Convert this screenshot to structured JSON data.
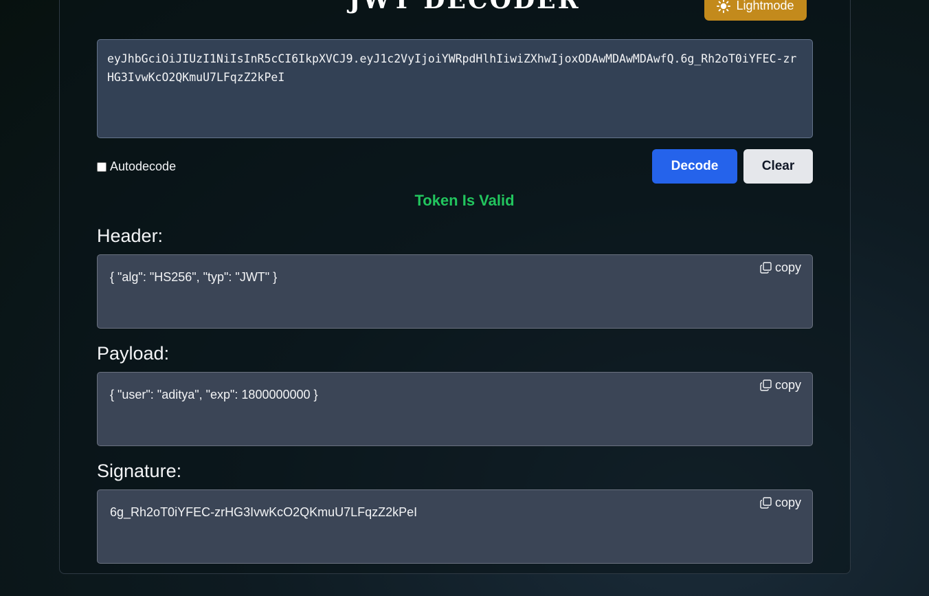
{
  "app": {
    "title": "JWT DECODER",
    "mode_button_label": "Lightmode",
    "mode_icon": "sun-icon"
  },
  "token_input": {
    "value": "eyJhbGciOiJIUzI1NiIsInR5cCI6IkpXVCJ9.eyJ1c2VyIjoiYWRpdHlhIiwiZXhwIjoxODAwMDAwMDAwfQ.6g_Rh2oT0iYFEC-zrHG3IvwKcO2QKmuU7LFqzZ2kPeI"
  },
  "controls": {
    "autodecode_label": "Autodecode",
    "autodecode_checked": false,
    "decode_label": "Decode",
    "clear_label": "Clear"
  },
  "status": {
    "text": "Token Is Valid",
    "color": "#22c55e"
  },
  "sections": {
    "header": {
      "label": "Header:",
      "content": "{ \"alg\": \"HS256\", \"typ\": \"JWT\" }",
      "copy_label": "copy"
    },
    "payload": {
      "label": "Payload:",
      "content": "{ \"user\": \"aditya\", \"exp\": 1800000000 }",
      "copy_label": "copy"
    },
    "signature": {
      "label": "Signature:",
      "content": "6g_Rh2oT0iYFEC-zrHG3IvwKcO2QKmuU7LFqzZ2kPeI",
      "copy_label": "copy"
    }
  },
  "colors": {
    "accent_blue": "#2563eb",
    "mode_button": "#c38a1c",
    "panel": "#3b4556",
    "input": "#334155"
  }
}
